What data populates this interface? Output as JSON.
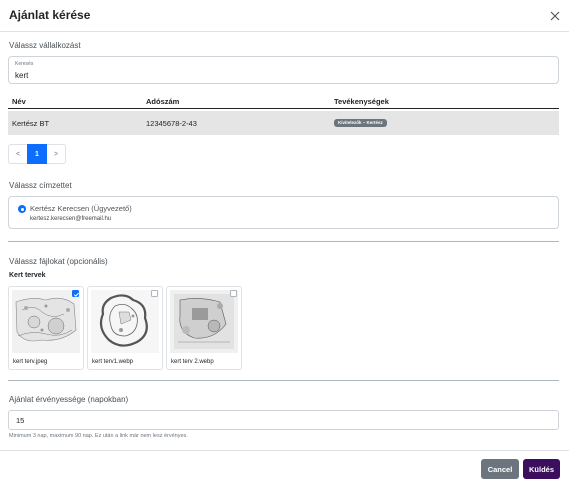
{
  "modal": {
    "title": "Ajánlat kérése"
  },
  "company": {
    "label": "Válassz vállalkozást",
    "search_placeholder": "Keresés",
    "search_value": "kert"
  },
  "table": {
    "columns": [
      "Név",
      "Adószám",
      "Tevékenységek"
    ],
    "rows": [
      {
        "name": "Kertész BT",
        "tax": "12345678-2-43",
        "badge": "Kivitelezők – Kertész"
      }
    ]
  },
  "pagination": {
    "prev": "<",
    "current": "1",
    "next": ">"
  },
  "recipient": {
    "label": "Válassz címzettet",
    "name": "Kertész Kerecsen (Ügyvezető)",
    "email": "kertesz.kerecsen@freemail.hu"
  },
  "files": {
    "label": "Válassz fájlokat (opcionális)",
    "group_label": "Kert tervek",
    "items": [
      {
        "name": "kert terv.jpeg",
        "checked": true
      },
      {
        "name": "kert terv1.webp",
        "checked": false
      },
      {
        "name": "kert terv 2.webp",
        "checked": false
      }
    ]
  },
  "validity": {
    "label": "Ajánlat érvényessége (napokban)",
    "value": "15",
    "help": "Minimum 3 nap, maximum 90 nap. Ez után a link már nem lesz érvényes."
  },
  "footer": {
    "cancel_label": "Cancel",
    "send_label": "Küldés"
  },
  "colors": {
    "primary": "#0d6efd",
    "secondary": "#6c757d",
    "send": "#3b0e5e"
  }
}
